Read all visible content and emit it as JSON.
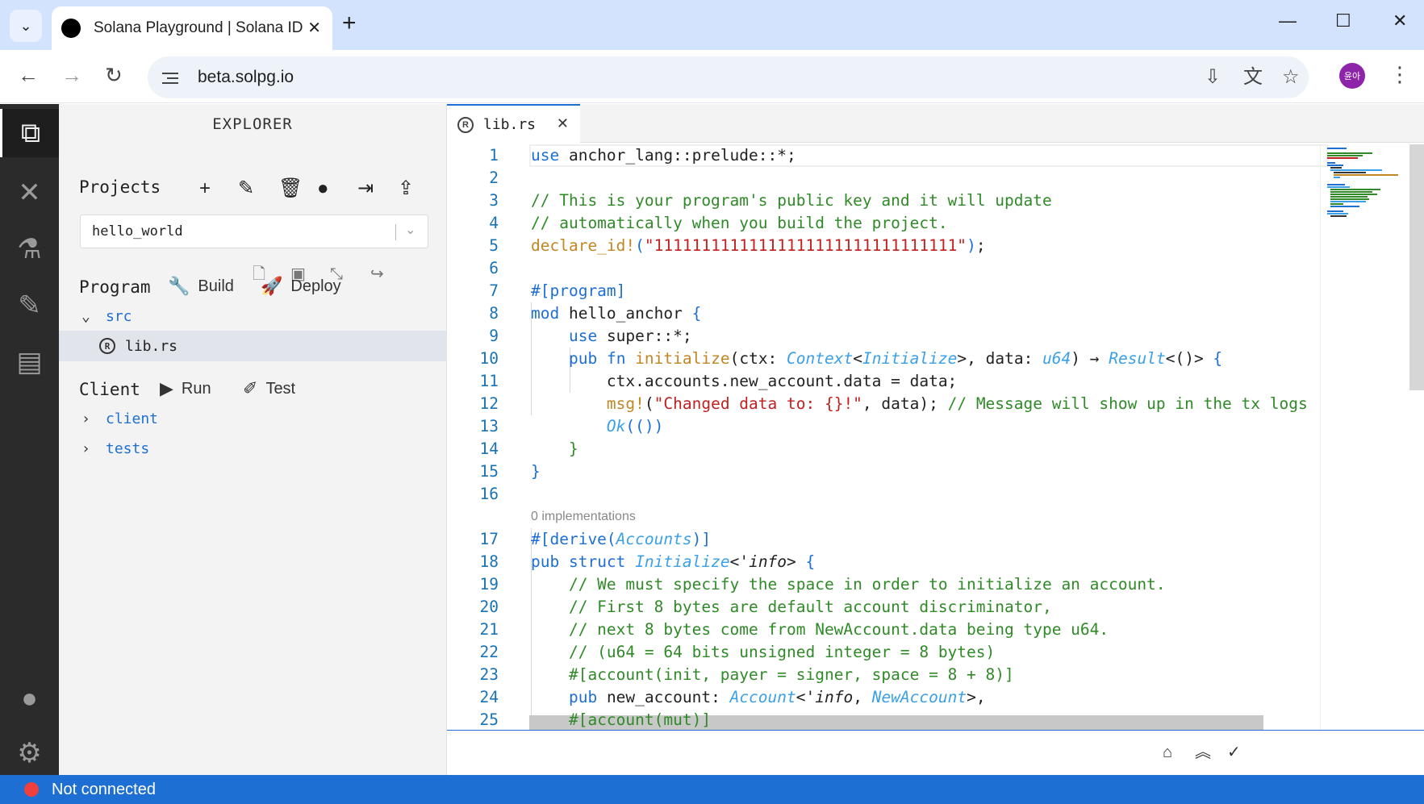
{
  "browser": {
    "tab_title": "Solana Playground | Solana IDE",
    "url": "beta.solpg.io",
    "profile_label": "윤아"
  },
  "explorer": {
    "title": "EXPLORER",
    "projects_label": "Projects",
    "project_selected": "hello_world",
    "program_label": "Program",
    "build_label": "Build",
    "deploy_label": "Deploy",
    "client_label": "Client",
    "run_label": "Run",
    "test_label": "Test",
    "tree": {
      "src": "src",
      "lib": "lib.rs",
      "client": "client",
      "tests": "tests"
    }
  },
  "editor": {
    "tab_label": "lib.rs",
    "codelens": "0 implementations",
    "line_numbers": [
      "1",
      "2",
      "3",
      "4",
      "5",
      "6",
      "7",
      "8",
      "9",
      "10",
      "11",
      "12",
      "13",
      "14",
      "15",
      "16",
      "17",
      "18",
      "19",
      "20",
      "21",
      "22",
      "23",
      "24",
      "25"
    ]
  },
  "status": {
    "connection": "Not connected"
  },
  "colors": {
    "accent": "#1e6fd4",
    "keyword": "#1e6fd4",
    "comment": "#2f8a27",
    "string": "#c21f1f",
    "macro": "#c28624",
    "type": "#3aa0e8",
    "status_dot": "#ef3f3f"
  }
}
